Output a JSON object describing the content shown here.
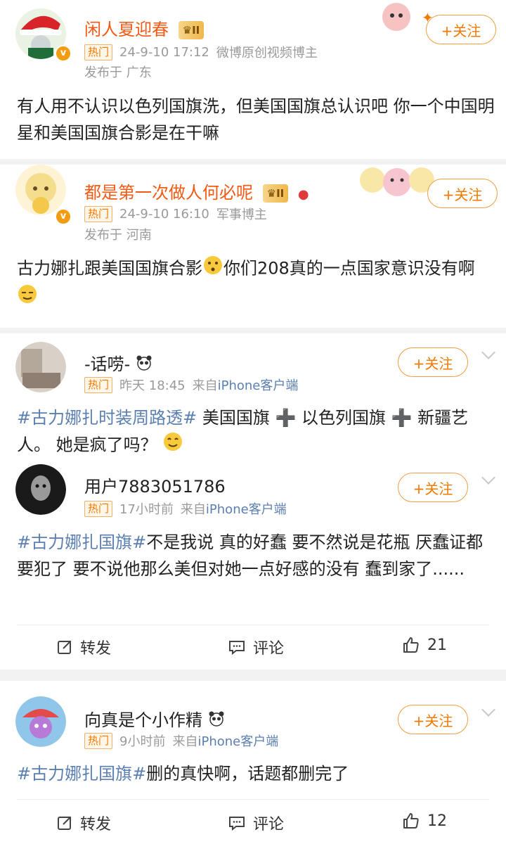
{
  "posts": [
    {
      "username": "闲人夏迎春",
      "rank": "II",
      "hot": "热门",
      "time": "24-9-10 17:12",
      "source": "微博原创视频博主",
      "region": "发布于 广东",
      "follow": "+关注",
      "text": "有人用不认识以色列国旗洗，但美国国旗总认识吧  你一个中国明星和美国国旗合影是在干嘛"
    },
    {
      "username": "都是第一次做人何必呢",
      "rank": "II",
      "hot": "热门",
      "time": "24-9-10 16:10",
      "source": "军事博主",
      "region": "发布于 河南",
      "follow": "+关注",
      "text_a": "古力娜扎跟美国国旗合影",
      "text_b": "你们208真的一点国家意识没有啊"
    },
    {
      "username": "-话唠-",
      "hot": "热门",
      "time": "昨天 18:45",
      "source_prefix": "来自",
      "source": "iPhone客户端",
      "follow": "+关注",
      "tag": "#古力娜扎时装周路透#",
      "text": " 美国国旗 ➕ 以色列国旗 ➕ 新疆艺人。 她是疯了吗？"
    },
    {
      "username": "用户7883051786",
      "hot": "热门",
      "time": "17小时前",
      "source_prefix": "来自",
      "source": "iPhone客户端",
      "follow": "+关注",
      "tag": "#古力娜扎国旗#",
      "text": "不是我说 真的好蠢 要不然说是花瓶 厌蠢证都要犯了 要不说他那么美但对她一点好感的没有 蠢到家了......",
      "repost": "转发",
      "comment": "评论",
      "likes": "21"
    },
    {
      "username": "向真是个小作精",
      "hot": "热门",
      "time": "9小时前",
      "source_prefix": "来自",
      "source": "iPhone客户端",
      "follow": "+关注",
      "tag": "#古力娜扎国旗#",
      "text": "删的真快啊，话题都删完了",
      "repost": "转发",
      "comment": "评论",
      "likes": "12"
    }
  ],
  "colors": {
    "accent": "#f07a00",
    "link": "#5b7fb1",
    "vip_name": "#f05a14"
  },
  "icons": [
    "santa-hat-avatar",
    "panda-emoji",
    "thinking-emoji",
    "sleepy-emoji",
    "drooling-emoji",
    "repost-icon",
    "comment-icon",
    "like-icon"
  ]
}
